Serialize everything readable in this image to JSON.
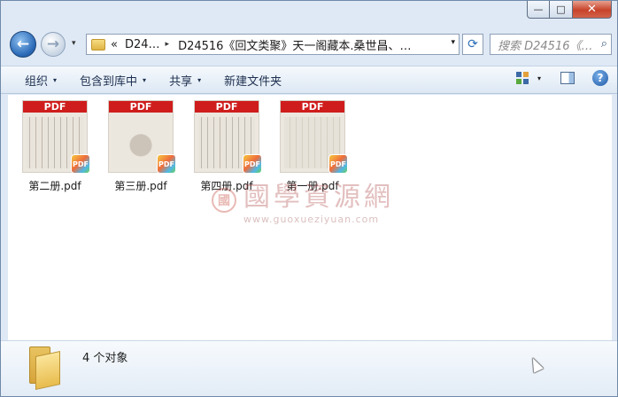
{
  "window": {
    "caption": {
      "minimize": "—",
      "maximize": "□",
      "close": "✕"
    }
  },
  "nav": {
    "back_glyph": "←",
    "forward_glyph": "→",
    "history_caret": "▾",
    "address": {
      "prefix": "«",
      "crumb1": "D24…",
      "separator": "▸",
      "crumb2": "D24516《回文类聚》天一阁藏本.桑世昌、…",
      "dropdown": "▾"
    },
    "refresh_glyph": "⟳",
    "search": {
      "placeholder": "搜索 D24516《…",
      "icon": "search-icon"
    }
  },
  "toolbar": {
    "organize": "组织",
    "include_in_library": "包含到库中",
    "share": "共享",
    "new_folder": "新建文件夹",
    "caret": "▾",
    "help": "?"
  },
  "files": [
    {
      "name": "第二册.pdf",
      "band": "PDF",
      "badge": "PDF",
      "thumb_style": "text"
    },
    {
      "name": "第三册.pdf",
      "band": "PDF",
      "badge": "PDF",
      "thumb_style": "sketch"
    },
    {
      "name": "第四册.pdf",
      "band": "PDF",
      "badge": "PDF",
      "thumb_style": "text"
    },
    {
      "name": "第一册.pdf",
      "band": "PDF",
      "badge": "PDF",
      "thumb_style": "faint"
    }
  ],
  "watermark": {
    "seal": "國",
    "title": "國學資源網",
    "url": "www.guoxueziyuan.com"
  },
  "details": {
    "count_text": "4 个对象"
  },
  "colors": {
    "pdf_red": "#cf1d1d",
    "window_frame": "#dfe9f5",
    "close_red": "#c7432a"
  }
}
